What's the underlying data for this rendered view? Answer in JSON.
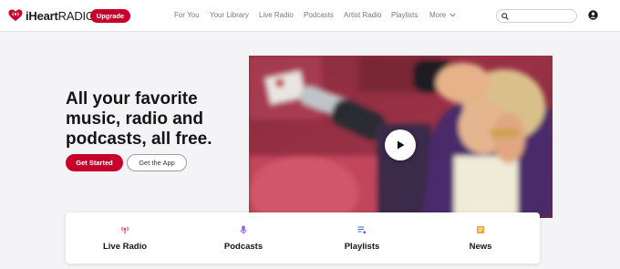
{
  "brand": {
    "logo_bold": "iHeart",
    "logo_light": "RADIO",
    "upgrade_label": "Upgrade",
    "accent": "#c6002b"
  },
  "nav": {
    "items": [
      {
        "label": "For You"
      },
      {
        "label": "Your Library"
      },
      {
        "label": "Live Radio"
      },
      {
        "label": "Podcasts"
      },
      {
        "label": "Artist Radio"
      },
      {
        "label": "Playlists"
      },
      {
        "label": "More"
      }
    ],
    "search_placeholder": "",
    "icons": {
      "search": "search-icon",
      "account": "user-account-icon",
      "more": "chevron-down-icon"
    }
  },
  "hero": {
    "title": "All your favorite music, radio and podcasts, all free.",
    "primary_cta": "Get Started",
    "secondary_cta": "Get the App"
  },
  "video": {
    "play_icon": "play-icon"
  },
  "categories": [
    {
      "label": "Live Radio",
      "icon": "radio-tower-icon",
      "color": "#e0375a"
    },
    {
      "label": "Podcasts",
      "icon": "microphone-icon",
      "color": "#8a5cf5"
    },
    {
      "label": "Playlists",
      "icon": "playlist-icon",
      "color": "#4a6ee0"
    },
    {
      "label": "News",
      "icon": "newspaper-icon",
      "color": "#f0a030"
    }
  ]
}
